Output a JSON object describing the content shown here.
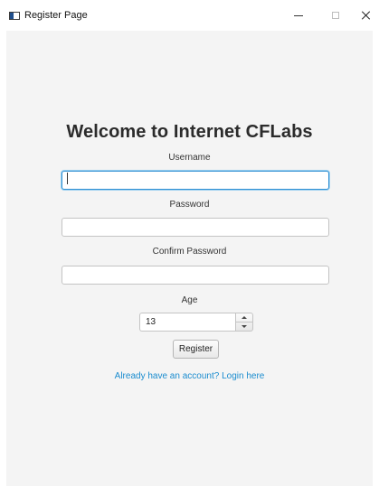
{
  "window": {
    "title": "Register Page",
    "minimize_icon": "minimize-icon",
    "maximize_icon": "maximize-icon",
    "close_icon": "close-icon"
  },
  "form": {
    "heading": "Welcome to Internet CFLabs",
    "username_label": "Username",
    "username_value": "",
    "password_label": "Password",
    "password_value": "",
    "confirm_password_label": "Confirm Password",
    "confirm_password_value": "",
    "age_label": "Age",
    "age_value": "13",
    "register_label": "Register",
    "login_link": "Already have an account? Login here"
  },
  "colors": {
    "content_background": "#f4f4f4",
    "link": "#1a8ccf",
    "focus_border": "#2f8fd3"
  }
}
